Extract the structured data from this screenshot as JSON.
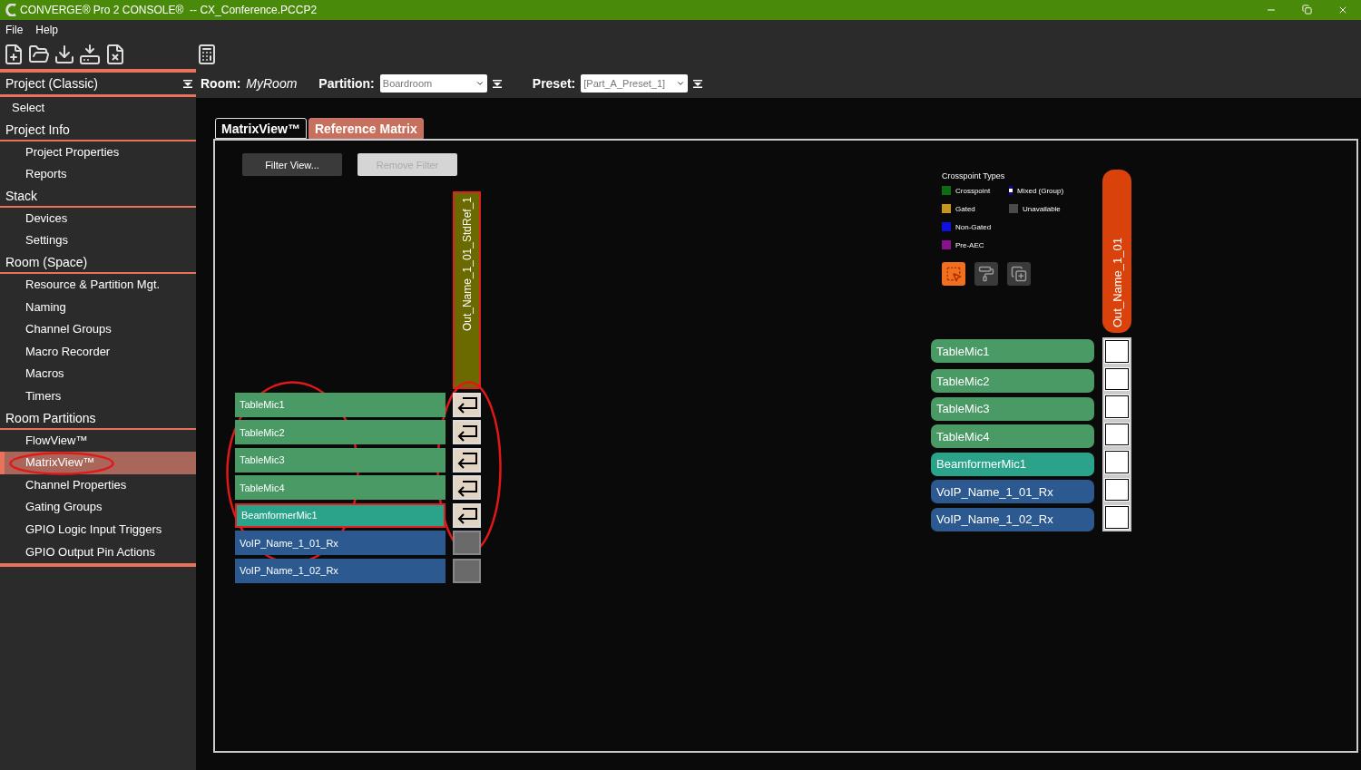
{
  "window": {
    "title": "CONVERGE® Pro 2 CONSOLE®  -- CX_Conference.PCCP2"
  },
  "menu": [
    "File",
    "Help"
  ],
  "sidebar": {
    "header": "Project (Classic)",
    "sections": [
      {
        "items": [
          {
            "label": "Select",
            "selected": false
          }
        ]
      },
      {
        "title": "Project Info",
        "items": [
          {
            "label": "Project Properties",
            "selected": false
          },
          {
            "label": "Reports",
            "selected": false
          }
        ]
      },
      {
        "title": "Stack",
        "items": [
          {
            "label": "Devices",
            "selected": false
          },
          {
            "label": "Settings",
            "selected": false
          }
        ]
      },
      {
        "title": "Room (Space)",
        "items": [
          {
            "label": "Resource & Partition Mgt.",
            "selected": false
          },
          {
            "label": "Naming",
            "selected": false
          },
          {
            "label": "Channel Groups",
            "selected": false
          },
          {
            "label": "Macro Recorder",
            "selected": false
          },
          {
            "label": "Macros",
            "selected": false
          },
          {
            "label": "Timers",
            "selected": false
          }
        ]
      },
      {
        "title": "Room Partitions",
        "items": [
          {
            "label": "FlowView™",
            "selected": false
          },
          {
            "label": "MatrixView™",
            "selected": true
          },
          {
            "label": "Channel Properties",
            "selected": false
          },
          {
            "label": "Gating Groups",
            "selected": false
          },
          {
            "label": "GPIO Logic Input Triggers",
            "selected": false
          },
          {
            "label": "GPIO Output Pin Actions",
            "selected": false
          }
        ]
      }
    ]
  },
  "context": {
    "room_label": "Room:",
    "room": "MyRoom",
    "partition_label": "Partition:",
    "partition": "Boardroom",
    "preset_label": "Preset:",
    "preset": "[Part_A_Preset_1]"
  },
  "tabs": [
    {
      "label": "MatrixView™",
      "selected": true
    },
    {
      "label": "Reference Matrix",
      "selected": false
    }
  ],
  "buttons": [
    {
      "label": "Filter View...",
      "disabled": false
    },
    {
      "label": "Remove Filter",
      "disabled": true
    }
  ],
  "matrix": {
    "output": "Out_Name_1_01_StdRef_1",
    "inputs": [
      {
        "name": "TableMic1",
        "kind": "mic",
        "selected": false,
        "crosspoint": {
          "kind": "routed"
        }
      },
      {
        "name": "TableMic2",
        "kind": "mic",
        "selected": false,
        "crosspoint": {
          "kind": "routed"
        }
      },
      {
        "name": "TableMic3",
        "kind": "mic",
        "selected": false,
        "crosspoint": {
          "kind": "routed"
        }
      },
      {
        "name": "TableMic4",
        "kind": "mic",
        "selected": false,
        "crosspoint": {
          "kind": "routed"
        }
      },
      {
        "name": "BeamformerMic1",
        "kind": "beamformer",
        "selected": true,
        "crosspoint": {
          "kind": "routed"
        }
      },
      {
        "name": "VoIP_Name_1_01_Rx",
        "kind": "voip",
        "selected": false,
        "crosspoint": {
          "kind": "unavailable"
        }
      },
      {
        "name": "VoIP_Name_1_02_Rx",
        "kind": "voip",
        "selected": false,
        "crosspoint": {
          "kind": "unavailable"
        }
      }
    ]
  },
  "reference": {
    "legend_title": "Crosspoint Types",
    "legend_columns": [
      [
        {
          "label": "Crosspoint",
          "color": "#0e6b12",
          "kind": "solid"
        },
        {
          "label": "Gated",
          "color": "#c8941e",
          "kind": "solid"
        },
        {
          "label": "Non-Gated",
          "color": "#1010e0",
          "kind": "solid"
        },
        {
          "label": "Pre-AEC",
          "color": "#8a1090",
          "kind": "solid"
        }
      ],
      [
        {
          "label": "Mixed (Group)",
          "color": "#0a0a8a",
          "kind": "mixed"
        },
        {
          "label": "Unavailable",
          "color": "#4a4a4a",
          "kind": "solid"
        }
      ]
    ],
    "tools": [
      {
        "kind": "select",
        "selected": true
      },
      {
        "kind": "paint",
        "selected": false
      },
      {
        "kind": "copy",
        "selected": false
      }
    ],
    "output": "Out_Name_1_01",
    "inputs": [
      {
        "name": "TableMic1",
        "kind": "mic"
      },
      {
        "name": "TableMic2",
        "kind": "mic"
      },
      {
        "name": "TableMic3",
        "kind": "mic"
      },
      {
        "name": "TableMic4",
        "kind": "mic"
      },
      {
        "name": "BeamformerMic1",
        "kind": "beamformer"
      },
      {
        "name": "VoIP_Name_1_01_Rx",
        "kind": "voip"
      },
      {
        "name": "VoIP_Name_1_02_Rx",
        "kind": "voip"
      }
    ]
  }
}
